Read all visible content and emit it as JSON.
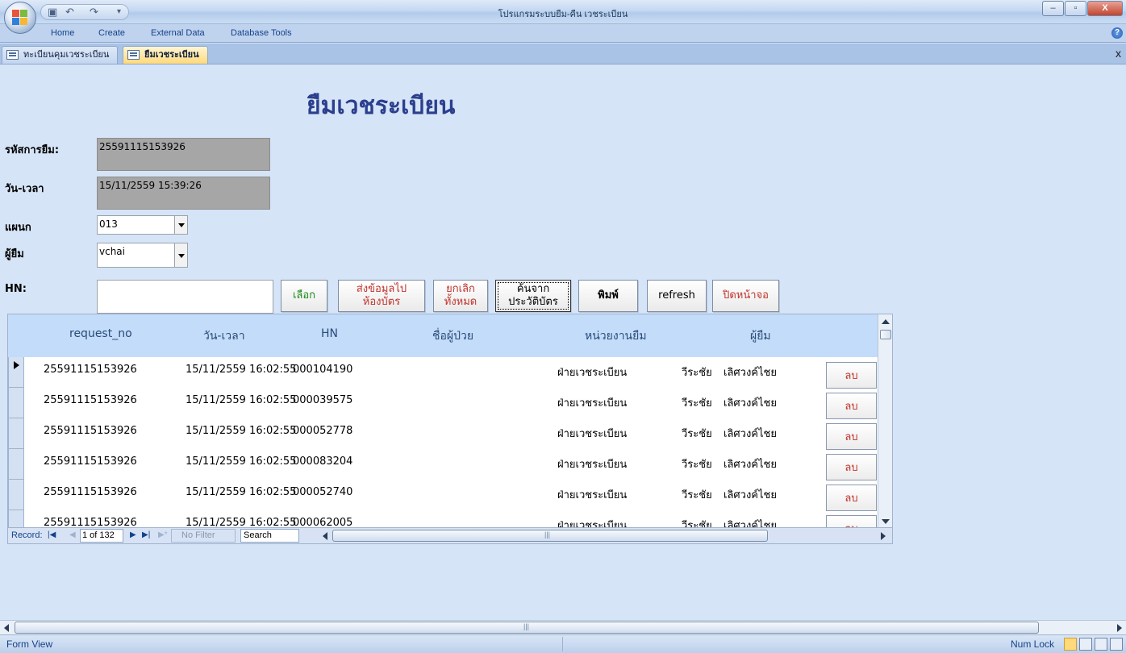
{
  "window": {
    "title": "โปรแกรมระบบยืม-คืน เวชระเบียน",
    "minimize": "–",
    "restore": "▫",
    "close": "X"
  },
  "qat": {
    "save_icon": "save-icon",
    "undo_icon": "undo-icon",
    "redo_icon": "redo-icon"
  },
  "ribbon": {
    "tabs": [
      "Home",
      "Create",
      "External Data",
      "Database Tools"
    ],
    "help": "?"
  },
  "doctabs": {
    "items": [
      {
        "label": "ทะเบียนคุมเวชระเบียน",
        "active": false
      },
      {
        "label": "ยืมเวชระเบียน",
        "active": true
      }
    ],
    "close": "x"
  },
  "form": {
    "title": "ยืมเวชระเบียน",
    "borrow_id_label": "รหัสการยืม:",
    "borrow_id_value": "25591115153926",
    "datetime_label": "วัน-เวลา",
    "datetime_value": "15/11/2559 15:39:26",
    "dept_label": "แผนก",
    "dept_value": "013",
    "borrower_label": "ผู้ยืม",
    "borrower_value": "vchai",
    "hn_label": "HN:",
    "hn_value": ""
  },
  "buttons": {
    "select": "เลือก",
    "send_line1": "ส่งข้อมูลไป",
    "send_line2": "ห้องบัตร",
    "cancel_line1": "ยกเลิก",
    "cancel_line2": "ทั้งหมด",
    "history_line1": "ค้นจาก",
    "history_line2": "ประวัติบัตร",
    "print": "พิมพ์",
    "refresh": "refresh",
    "close": "ปิดหน้าจอ"
  },
  "subform": {
    "columns": [
      "request_no",
      "วัน-เวลา",
      "HN",
      "ชื่อผู้ป่วย",
      "หน่วยงานยืม",
      "ผู้ยืม"
    ],
    "delete_label": "ลบ",
    "rows": [
      {
        "request_no": "25591115153926",
        "datetime": "15/11/2559 16:02:55",
        "hn": "000104190",
        "patient": "",
        "unit": "ฝ่ายเวชระเบียน",
        "first": "วีระชัย",
        "last": "เลิศวงค์ไชย"
      },
      {
        "request_no": "25591115153926",
        "datetime": "15/11/2559 16:02:55",
        "hn": "000039575",
        "patient": "",
        "unit": "ฝ่ายเวชระเบียน",
        "first": "วีระชัย",
        "last": "เลิศวงค์ไชย"
      },
      {
        "request_no": "25591115153926",
        "datetime": "15/11/2559 16:02:55",
        "hn": "000052778",
        "patient": "",
        "unit": "ฝ่ายเวชระเบียน",
        "first": "วีระชัย",
        "last": "เลิศวงค์ไชย"
      },
      {
        "request_no": "25591115153926",
        "datetime": "15/11/2559 16:02:55",
        "hn": "000083204",
        "patient": "",
        "unit": "ฝ่ายเวชระเบียน",
        "first": "วีระชัย",
        "last": "เลิศวงค์ไชย"
      },
      {
        "request_no": "25591115153926",
        "datetime": "15/11/2559 16:02:55",
        "hn": "000052740",
        "patient": "",
        "unit": "ฝ่ายเวชระเบียน",
        "first": "วีระชัย",
        "last": "เลิศวงค์ไชย"
      },
      {
        "request_no": "25591115153926",
        "datetime": "15/11/2559 16:02:55",
        "hn": "000062005",
        "patient": "",
        "unit": "ฝ่ายเวชระเบียน",
        "first": "วีระชัย",
        "last": "เลิศวงค์ไชย"
      }
    ],
    "nav": {
      "record_label": "Record:",
      "counter": "1 of 132",
      "no_filter": "No Filter",
      "search": "Search"
    }
  },
  "status": {
    "view": "Form View",
    "numlock": "Num Lock"
  }
}
